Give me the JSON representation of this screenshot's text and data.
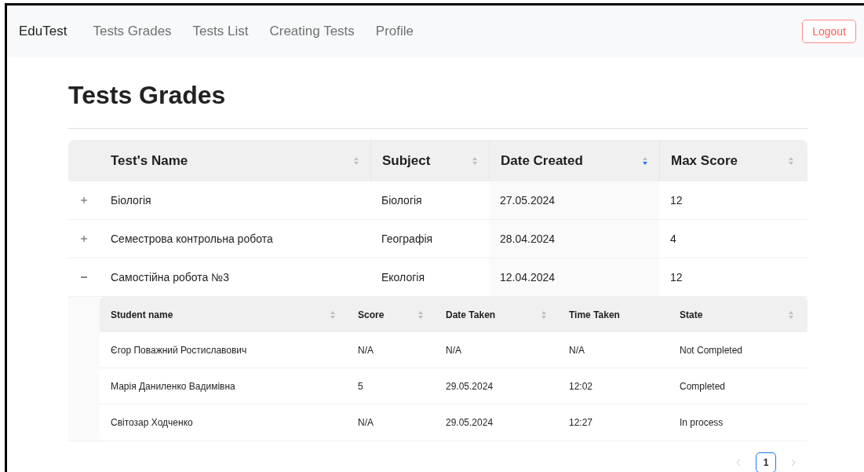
{
  "navbar": {
    "brand": "EduTest",
    "links": [
      {
        "label": "Tests Grades",
        "selected": false
      },
      {
        "label": "Tests List",
        "selected": false
      },
      {
        "label": "Creating Tests",
        "selected": false
      },
      {
        "label": "Profile",
        "selected": false
      }
    ],
    "logout": "Logout"
  },
  "page_title": "Tests Grades",
  "table": {
    "columns": [
      {
        "label": "Test's Name",
        "sortable": true,
        "sorted_desc": false
      },
      {
        "label": "Subject",
        "sortable": true,
        "sorted_desc": false
      },
      {
        "label": "Date Created",
        "sortable": true,
        "sorted_desc": true
      },
      {
        "label": "Max Score",
        "sortable": true,
        "sorted_desc": false
      }
    ],
    "rows": [
      {
        "expanded": false,
        "cells": [
          "Біологія",
          "Біологія",
          "27.05.2024",
          "12"
        ]
      },
      {
        "expanded": false,
        "cells": [
          "Семестрова контрольна робота",
          "Географія",
          "28.04.2024",
          "4"
        ]
      },
      {
        "expanded": true,
        "cells": [
          "Самостійна робота №3",
          "Екологія",
          "12.04.2024",
          "12"
        ],
        "subtable": {
          "columns": [
            {
              "label": "Student name",
              "sortable": true
            },
            {
              "label": "Score",
              "sortable": true
            },
            {
              "label": "Date Taken",
              "sortable": true
            },
            {
              "label": "Time Taken",
              "sortable": false
            },
            {
              "label": "State",
              "sortable": true
            }
          ],
          "rows": [
            [
              "Єгор Поважний Ростиславович",
              "N/A",
              "N/A",
              "N/A",
              "Not Completed"
            ],
            [
              "Марія Даниленко Вадимівна",
              "5",
              "29.05.2024",
              "12:02",
              "Completed"
            ],
            [
              "Світозар Ходченко",
              "N/A",
              "29.05.2024",
              "12:27",
              "In process"
            ]
          ]
        }
      }
    ]
  },
  "pagination": {
    "prev_disabled": true,
    "next_disabled": true,
    "pages": [
      {
        "label": "1",
        "selected": true
      }
    ]
  }
}
